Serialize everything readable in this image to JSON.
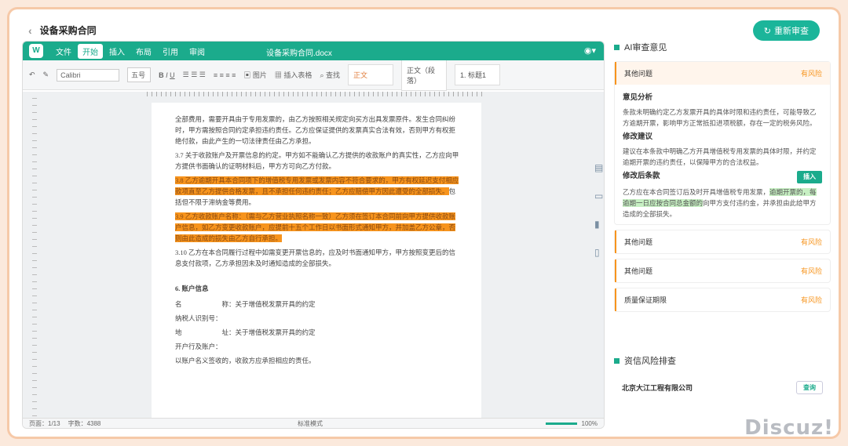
{
  "app": {
    "title": "设备采购合同",
    "review_btn": "重新审查"
  },
  "menubar": {
    "logo": "W",
    "items": [
      "文件",
      "开始",
      "插入",
      "布局",
      "引用",
      "审阅"
    ],
    "active": 1,
    "doc_title": "设备采购合同.docx"
  },
  "toolbar": {
    "font": "Calibri",
    "size": "五号",
    "style1": "正文",
    "style2": "正文（段落）",
    "style3": "1. 标题1",
    "btn_image": "图片",
    "btn_table": "插入表格",
    "btn_find": "查找"
  },
  "document": {
    "para1": "全部费用，需要开具由于专用发票的，由乙方按照相关规定向买方出具发票原件。发生合同纠纷时，甲方需按照合同约定承担违约责任。乙方应保证提供的发票真实合法有效，否则甲方有权拒绝付款，由此产生的一切法律责任由乙方承担。",
    "para2": "3.7 关于收款账户及开票信息的约定。甲方如不能确认乙方提供的收款账户的真实性，乙方应向甲方提供书面确认的证明材料后，甲方方可向乙方付款。",
    "para3_hl": "3.8 乙方逾期开具本合同项下的增值税专用发票或发票内容不符合要求的，甲方有权延迟支付相应款项直至乙方提供合格发票，且不承担任何违约责任；乙方应赔偿甲方因此遭受的全部损失。",
    "para3_tail": "包括但不限于滞纳金等费用。",
    "para4_hl": "3.9 乙方收款账户名称：（需与乙方营业执照名称一致）乙方须在签订本合同前向甲方提供收款账户信息，如乙方变更收款账户，应提前十五个工作日以书面形式通知甲方，并加盖乙方公章，否则由此造成的损失由乙方自行承担。",
    "para5": "3.10 乙方在本合同履行过程中如需变更开票信息的，应及时书面通知甲方，甲方按照变更后的信息支付款项，乙方承担因未及时通知造成的全部损失。",
    "section": "6. 账户信息",
    "fields": [
      "名　　　　　　称：关于增值税发票开具的约定",
      "纳税人识别号：",
      "地　　　　　　址：关于增值税发票开具的约定",
      "开户行及账户：",
      "以账户名义签收的，收款方应承担相应的责任。"
    ]
  },
  "side_icons": [
    "comment-icon",
    "track-icon",
    "bookmark-icon",
    "document-icon"
  ],
  "status": {
    "left": "页面：1/13",
    "words": "字数：4388",
    "center": "标准模式",
    "zoom": "100%"
  },
  "panel": {
    "title": "AI审查意见",
    "open_item": {
      "label": "其他问题",
      "risk": "有风险",
      "analysis_title": "意见分析",
      "analysis": "条款未明确约定乙方发票开具的具体时限和违约责任，可能导致乙方逾期开票，影响甲方正常抵扣进项税额，存在一定的税务风险。",
      "suggest_title": "修改建议",
      "suggest": "建议在本条款中明确乙方开具增值税专用发票的具体时限，并约定逾期开票的违约责任，以保障甲方的合法权益。",
      "rewrite_title": "修改后条款",
      "insert": "插入",
      "rewrite_a": "乙方应在本合同签订后及时开具增值税专用发票，",
      "rewrite_b": "逾期开票的，每逾期一日应按合同总金额的",
      "rewrite_c": "向甲方支付违约金，并承担由此给甲方造成的全部损失。"
    },
    "items": [
      {
        "label": "其他问题",
        "risk": "有风险"
      },
      {
        "label": "其他问题",
        "risk": "有风险"
      },
      {
        "label": "质量保证期限",
        "risk": "有风险"
      }
    ],
    "credit_title": "资信风险排查",
    "company": "北京大江工程有限公司",
    "query": "查询"
  },
  "watermark": "Discuz!"
}
